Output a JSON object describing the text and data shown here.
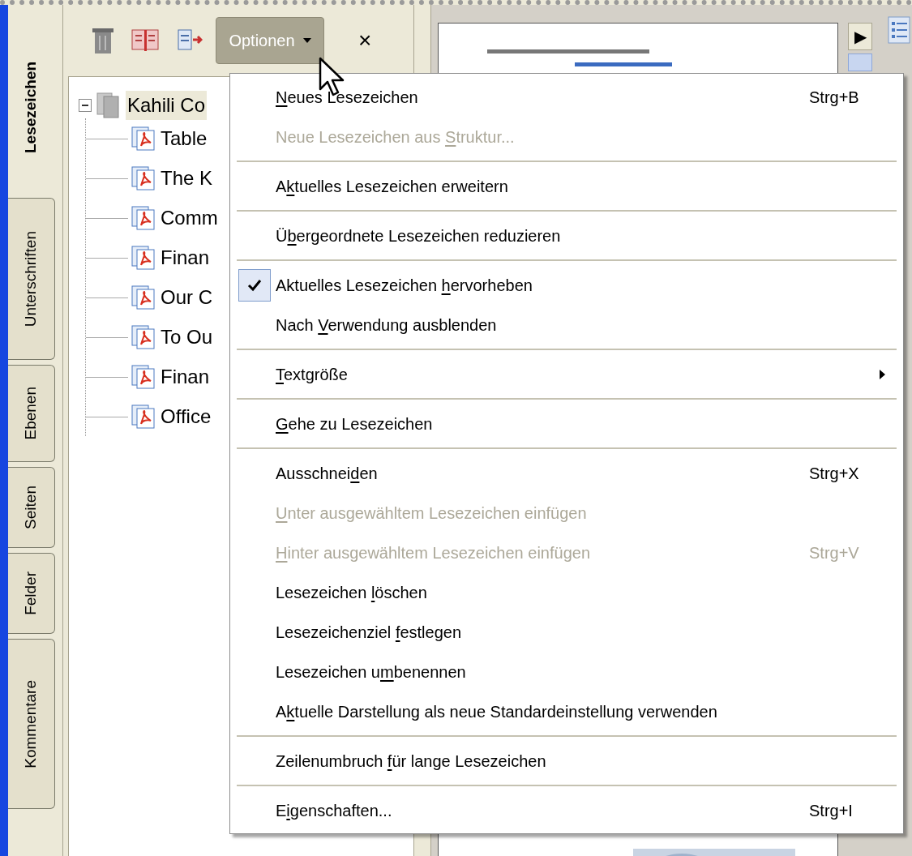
{
  "side_tabs": [
    {
      "label": "Lesezeichen",
      "selected": true
    },
    {
      "label": "Unterschriften",
      "selected": false
    },
    {
      "label": "Ebenen",
      "selected": false
    },
    {
      "label": "Seiten",
      "selected": false
    },
    {
      "label": "Felder",
      "selected": false
    },
    {
      "label": "Kommentare",
      "selected": false
    }
  ],
  "toolbar": {
    "options_button": "Optionen",
    "close_button": "×"
  },
  "bookmarks": [
    {
      "label": "Kahili Co",
      "selected": true,
      "expanded": true,
      "children": [
        {
          "label": "Table",
          "selected": false
        },
        {
          "label": "The K",
          "selected": false
        },
        {
          "label": "Comm",
          "selected": false
        },
        {
          "label": "Finan",
          "selected": false
        },
        {
          "label": "Our C",
          "selected": false
        },
        {
          "label": "To Ou",
          "selected": false
        },
        {
          "label": "Finan",
          "selected": false
        },
        {
          "label": "Office",
          "selected": false
        }
      ]
    }
  ],
  "page_nav": {
    "next_button": "▶"
  },
  "menu": {
    "items": [
      {
        "kind": "item",
        "accel_key": "N",
        "text_after": "eues Lesezeichen",
        "shortcut": "Strg+B",
        "disabled": false,
        "checked": false,
        "submenu": false
      },
      {
        "kind": "item",
        "text_before": "Neue Lesezeichen aus ",
        "accel_key": "S",
        "text_after": "truktur...",
        "disabled": true,
        "checked": false,
        "submenu": false
      },
      {
        "kind": "separator"
      },
      {
        "kind": "item",
        "text_before": "A",
        "accel_key": "k",
        "text_after": "tuelles Lesezeichen erweitern",
        "disabled": false,
        "checked": false,
        "submenu": false
      },
      {
        "kind": "separator"
      },
      {
        "kind": "item",
        "text_before": "Ü",
        "accel_key": "b",
        "text_after": "ergeordnete Lesezeichen reduzieren",
        "disabled": false,
        "checked": false,
        "submenu": false
      },
      {
        "kind": "separator"
      },
      {
        "kind": "item",
        "text_before": "Aktuelles Lesezeichen ",
        "accel_key": "h",
        "text_after": "ervorheben",
        "disabled": false,
        "checked": true,
        "submenu": false
      },
      {
        "kind": "item",
        "text_before": "Nach ",
        "accel_key": "V",
        "text_after": "erwendung ausblenden",
        "disabled": false,
        "checked": false,
        "submenu": false
      },
      {
        "kind": "separator"
      },
      {
        "kind": "item",
        "accel_key": "T",
        "text_after": "extgröße",
        "disabled": false,
        "checked": false,
        "submenu": true
      },
      {
        "kind": "separator"
      },
      {
        "kind": "item",
        "accel_key": "G",
        "text_after": "ehe zu Lesezeichen",
        "disabled": false,
        "checked": false,
        "submenu": false
      },
      {
        "kind": "separator"
      },
      {
        "kind": "item",
        "text_before": "Ausschnei",
        "accel_key": "d",
        "text_after": "en",
        "shortcut": "Strg+X",
        "disabled": false,
        "checked": false,
        "submenu": false
      },
      {
        "kind": "item",
        "accel_key": "U",
        "text_after": "nter ausgewähltem Lesezeichen einfügen",
        "disabled": true,
        "checked": false,
        "submenu": false
      },
      {
        "kind": "item",
        "accel_key": "H",
        "text_after": "inter ausgewähltem Lesezeichen einfügen",
        "shortcut": "Strg+V",
        "disabled": true,
        "checked": false,
        "submenu": false
      },
      {
        "kind": "item",
        "text_before": "Lesezeichen ",
        "accel_key": "l",
        "text_after": "öschen",
        "disabled": false,
        "checked": false,
        "submenu": false
      },
      {
        "kind": "item",
        "text_before": "Lesezeichenziel ",
        "accel_key": "f",
        "text_after": "estlegen",
        "disabled": false,
        "checked": false,
        "submenu": false
      },
      {
        "kind": "item",
        "text_before": "Lesezeichen u",
        "accel_key": "m",
        "text_after": "benennen",
        "disabled": false,
        "checked": false,
        "submenu": false
      },
      {
        "kind": "item",
        "text_before": "A",
        "accel_key": "k",
        "text_after": "tuelle Darstellung als neue Standardeinstellung verwenden",
        "disabled": false,
        "checked": false,
        "submenu": false
      },
      {
        "kind": "separator"
      },
      {
        "kind": "item",
        "text_before": "Zeilenumbruch ",
        "accel_key": "f",
        "text_after": "ür lange Lesezeichen",
        "disabled": false,
        "checked": false,
        "submenu": false
      },
      {
        "kind": "separator"
      },
      {
        "kind": "item",
        "text_before": "E",
        "accel_key": "i",
        "text_after": "genschaften...",
        "shortcut": "Strg+I",
        "disabled": false,
        "checked": false,
        "submenu": false
      }
    ]
  }
}
